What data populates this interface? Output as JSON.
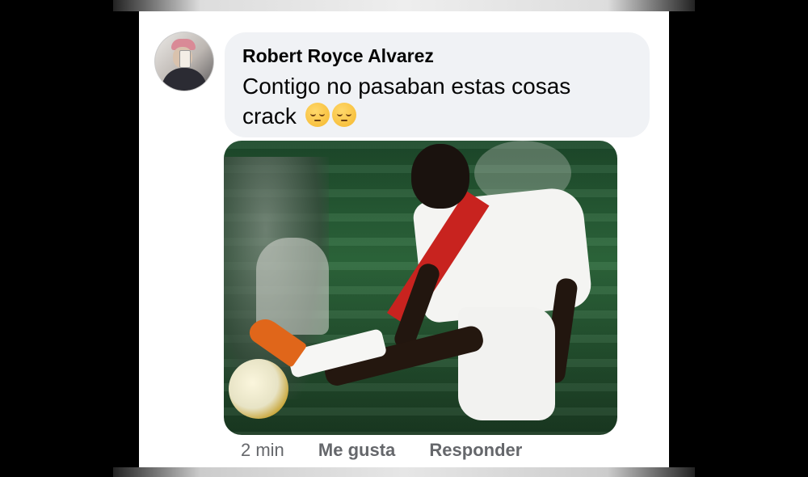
{
  "comment": {
    "author": "Robert Royce Alvarez",
    "text_line1": "Contigo no pasaban estas cosas",
    "text_line2": "crack",
    "emoji": [
      "pensive-face",
      "pensive-face"
    ],
    "attachment": {
      "kind": "photo",
      "description_icon": "football-player-photo"
    },
    "timestamp": "2 min",
    "actions": {
      "like": "Me gusta",
      "reply": "Responder"
    }
  },
  "colors": {
    "bubble_bg": "#f0f2f5",
    "meta_text": "#65676b",
    "frame_bg": "#000000",
    "panel_bg": "#ffffff"
  }
}
